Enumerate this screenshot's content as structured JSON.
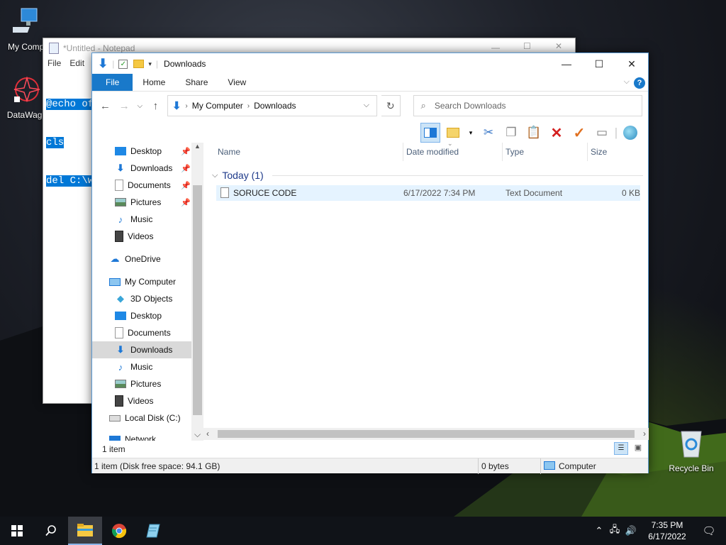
{
  "desktop": {
    "icons": [
      {
        "label": "My Compu"
      },
      {
        "label": "DataWago"
      },
      {
        "label": "Recycle Bin"
      }
    ]
  },
  "notepad": {
    "title": "*Untitled - Notepad",
    "menu": [
      "File",
      "Edit"
    ],
    "lines": [
      "@echo of",
      "cls",
      "del C:\\w"
    ]
  },
  "explorer": {
    "title": "Downloads",
    "ribbon_tabs": [
      "File",
      "Home",
      "Share",
      "View"
    ],
    "breadcrumb": [
      "My Computer",
      "Downloads"
    ],
    "search_placeholder": "Search Downloads",
    "nav": [
      {
        "label": "Desktop",
        "pinned": true
      },
      {
        "label": "Downloads",
        "pinned": true
      },
      {
        "label": "Documents",
        "pinned": true
      },
      {
        "label": "Pictures",
        "pinned": true
      },
      {
        "label": "Music"
      },
      {
        "label": "Videos"
      },
      {
        "label": "OneDrive"
      },
      {
        "label": "My Computer"
      },
      {
        "label": "3D Objects"
      },
      {
        "label": "Desktop"
      },
      {
        "label": "Documents"
      },
      {
        "label": "Downloads",
        "selected": true
      },
      {
        "label": "Music"
      },
      {
        "label": "Pictures"
      },
      {
        "label": "Videos"
      },
      {
        "label": "Local Disk (C:)"
      },
      {
        "label": "Network"
      }
    ],
    "columns": [
      "Name",
      "Date modified",
      "Type",
      "Size"
    ],
    "group": "Today (1)",
    "files": [
      {
        "name": "SORUCE CODE",
        "date": "6/17/2022 7:34 PM",
        "type": "Text Document",
        "size": "0 KB"
      }
    ],
    "item_count": "1 item",
    "status_left": "1 item (Disk free space: 94.1 GB)",
    "status_mid": "0 bytes",
    "status_right": "Computer"
  },
  "taskbar": {
    "time": "7:35 PM",
    "date": "6/17/2022"
  }
}
